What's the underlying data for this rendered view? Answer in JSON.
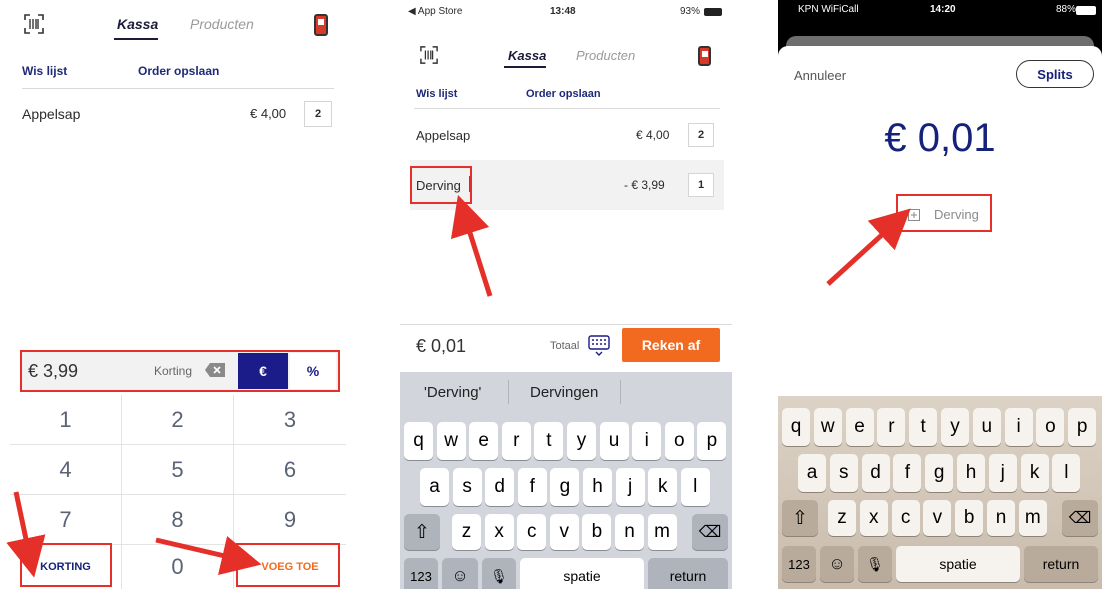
{
  "panel1": {
    "tabs": [
      {
        "label": "Kassa"
      },
      {
        "label": "Producten"
      }
    ],
    "actions": {
      "clear": "Wis lijst",
      "save": "Order opslaan"
    },
    "item": {
      "name": "Appelsap",
      "price": "€ 4,00",
      "qty": "2"
    },
    "discount": {
      "value": "€ 3,99",
      "label": "Korting",
      "eur": "€",
      "pct": "%"
    },
    "keypad": [
      "1",
      "2",
      "3",
      "4",
      "5",
      "6",
      "7",
      "8",
      "9"
    ],
    "bottom": {
      "korting": "KORTING",
      "zero": "0",
      "voeg": "VOEG TOE"
    }
  },
  "panel2": {
    "status": {
      "left": "◀ App Store",
      "time": "13:48",
      "battery": "93%"
    },
    "tabs": [
      {
        "label": "Kassa"
      },
      {
        "label": "Producten"
      }
    ],
    "actions": {
      "clear": "Wis lijst",
      "save": "Order opslaan"
    },
    "items": [
      {
        "name": "Appelsap",
        "price": "€ 4,00",
        "qty": "2"
      },
      {
        "name": "Derving",
        "price": "- € 3,99",
        "qty": "1"
      }
    ],
    "total": {
      "value": "€ 0,01",
      "label": "Totaal",
      "pay": "Reken af"
    },
    "suggestions": [
      "'Derving'",
      "Dervingen"
    ],
    "keys": {
      "row1": [
        "q",
        "w",
        "e",
        "r",
        "t",
        "y",
        "u",
        "i",
        "o",
        "p"
      ],
      "row2": [
        "a",
        "s",
        "d",
        "f",
        "g",
        "h",
        "j",
        "k",
        "l"
      ],
      "row3": [
        "z",
        "x",
        "c",
        "v",
        "b",
        "n",
        "m"
      ],
      "num": "123",
      "space": "spatie",
      "return": "return"
    }
  },
  "panel3": {
    "status": {
      "left": "KPN WiFiCall",
      "time": "14:20",
      "battery": "88%"
    },
    "cancel": "Annuleer",
    "split": "Splits",
    "amount": "€ 0,01",
    "note_placeholder": "Derving",
    "keys": {
      "row1": [
        "q",
        "w",
        "e",
        "r",
        "t",
        "y",
        "u",
        "i",
        "o",
        "p"
      ],
      "row2": [
        "a",
        "s",
        "d",
        "f",
        "g",
        "h",
        "j",
        "k",
        "l"
      ],
      "row3": [
        "z",
        "x",
        "c",
        "v",
        "b",
        "n",
        "m"
      ],
      "num": "123",
      "space": "spatie",
      "return": "return"
    }
  },
  "colors": {
    "accent": "#1b1b8a",
    "orange": "#f26a1f",
    "highlight": "#e5302a"
  }
}
